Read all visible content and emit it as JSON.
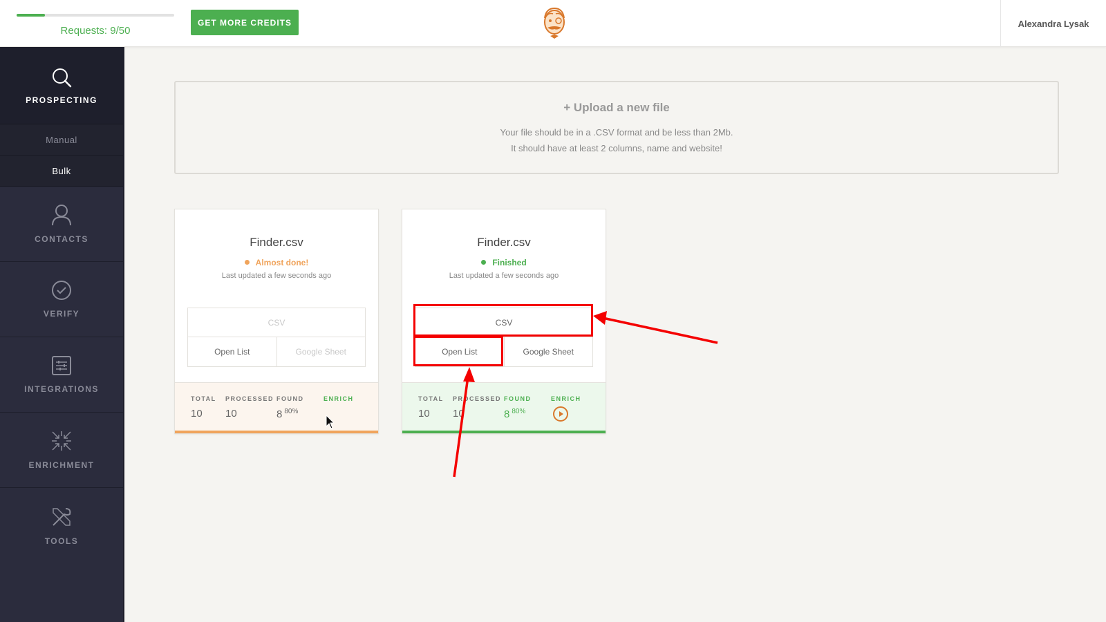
{
  "header": {
    "requests_label": "Requests: 9/50",
    "requests_progress": 0.18,
    "credits_button": "GET MORE CREDITS",
    "user_name": "Alexandra Lysak"
  },
  "sidebar": {
    "top": {
      "label": "PROSPECTING",
      "icon": "search-icon"
    },
    "sub_items": [
      {
        "label": "Manual",
        "active": false
      },
      {
        "label": "Bulk",
        "active": true
      }
    ],
    "items": [
      {
        "label": "CONTACTS",
        "icon": "person-icon"
      },
      {
        "label": "VERIFY",
        "icon": "check-circle-icon"
      },
      {
        "label": "INTEGRATIONS",
        "icon": "sliders-icon"
      },
      {
        "label": "ENRICHMENT",
        "icon": "arrows-converge-icon"
      },
      {
        "label": "TOOLS",
        "icon": "tools-icon"
      }
    ]
  },
  "upload": {
    "title": "+ Upload a new file",
    "line1": "Your file should be in a .CSV format and be less than 2Mb.",
    "line2": "It should have at least 2 columns, name and website!"
  },
  "cards": [
    {
      "filename": "Finder.csv",
      "status": "Almost done!",
      "status_color": "#f0a45c",
      "updated": "Last updated a few seconds ago",
      "csv_label": "CSV",
      "open_list_label": "Open List",
      "google_sheet_label": "Google Sheet",
      "stats": {
        "total_label": "TOTAL",
        "total": "10",
        "processed_label": "PROCESSED",
        "processed": "10",
        "found_label": "FOUND",
        "found": "8",
        "found_pct": "80%",
        "enrich_label": "ENRICH"
      }
    },
    {
      "filename": "Finder.csv",
      "status": "Finished",
      "status_color": "#4caf50",
      "updated": "Last updated a few seconds ago",
      "csv_label": "CSV",
      "open_list_label": "Open List",
      "google_sheet_label": "Google Sheet",
      "stats": {
        "total_label": "TOTAL",
        "total": "10",
        "processed_label": "PROCESSED",
        "processed": "10",
        "found_label": "FOUND",
        "found": "8",
        "found_pct": "80%",
        "enrich_label": "ENRICH"
      }
    }
  ],
  "colors": {
    "accent_green": "#4caf50",
    "accent_orange": "#f0a45c",
    "sidebar_bg": "#2b2c3d",
    "annotation_red": "#f40000"
  }
}
